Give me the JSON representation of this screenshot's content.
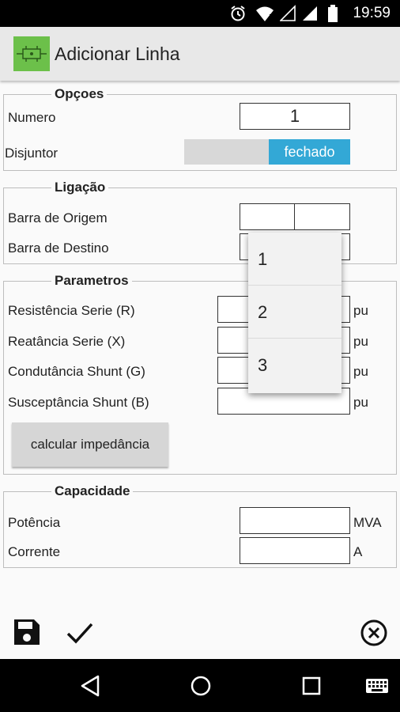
{
  "status_bar": {
    "time": "19:59",
    "icons": [
      "alarm-icon",
      "wifi-icon",
      "signal-icon",
      "signal-icon",
      "battery-icon"
    ]
  },
  "app_bar": {
    "title": "Adicionar Linha",
    "icon": "circuit-app-icon"
  },
  "opcoes": {
    "legend": "Opçoes",
    "numero_label": "Numero",
    "numero_value": "1",
    "disjuntor_label": "Disjuntor",
    "disjuntor_state": "fechado"
  },
  "ligacao": {
    "legend": "Ligação",
    "origem_label": "Barra de Origem",
    "destino_label": "Barra de Destino"
  },
  "parametros": {
    "legend": "Parametros",
    "rows": [
      {
        "label": "Resistência Serie (R)",
        "unit": "pu"
      },
      {
        "label": "Reatância Serie (X)",
        "unit": "pu"
      },
      {
        "label": "Condutância Shunt (G)",
        "unit": "pu"
      },
      {
        "label": "Susceptância Shunt (B)",
        "unit": "pu"
      }
    ],
    "calc_button": "calcular impedância"
  },
  "capacidade": {
    "legend": "Capacidade",
    "potencia_label": "Potência",
    "potencia_unit": "MVA",
    "corrente_label": "Corrente",
    "corrente_unit": "A"
  },
  "dropdown": {
    "options": [
      "1",
      "2",
      "3"
    ]
  },
  "bottom_actions": [
    "save-icon",
    "check-icon",
    "close-circle-icon"
  ],
  "nav_bar": [
    "back-icon",
    "home-icon",
    "recents-icon",
    "keyboard-icon"
  ]
}
